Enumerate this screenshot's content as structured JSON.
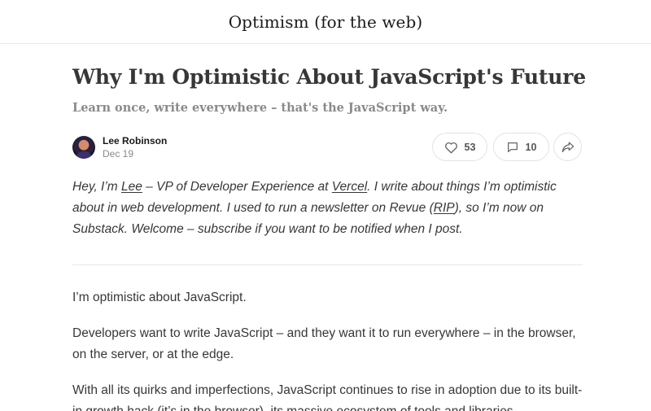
{
  "publication": {
    "title": "Optimism (for the web)"
  },
  "post": {
    "title": "Why I'm Optimistic About JavaScript's Future",
    "subtitle": "Learn once, write everywhere – that's the JavaScript way.",
    "author": "Lee Robinson",
    "date": "Dec 19"
  },
  "actions": {
    "like_count": "53",
    "comment_count": "10",
    "icons": [
      "heart-icon",
      "comment-icon",
      "share-icon"
    ]
  },
  "intro": {
    "t1": "Hey, I’m ",
    "link_lee": "Lee",
    "t2": " – VP of Developer Experience at ",
    "link_vercel": "Vercel",
    "t3": ". I write about things I’m optimistic about in web development. I used to run a newsletter on Revue (",
    "link_rip": "RIP",
    "t4": "), so I’m now on Substack. Welcome – subscribe if you want to be notified when I post."
  },
  "body": {
    "p1": "I’m optimistic about JavaScript.",
    "p2": "Developers want to write JavaScript – and they want it to run everywhere – in the browser, on the server, or at the edge.",
    "p3": "With all its quirks and imperfections, JavaScript continues to rise in adoption due to its built-in growth hack (it’s in the browser), its massive ecosystem of tools and libraries"
  }
}
